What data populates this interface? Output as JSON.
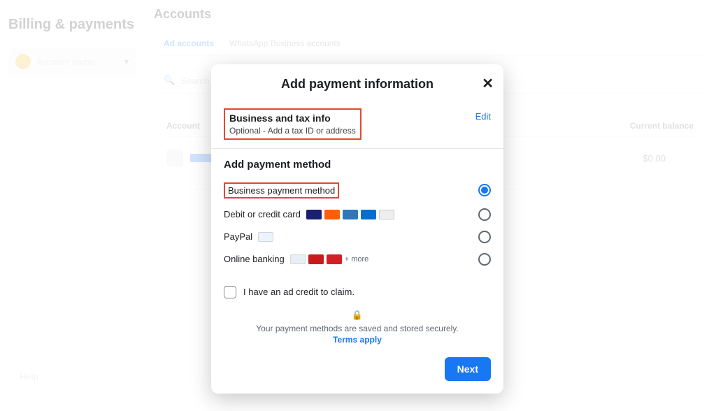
{
  "sidebar": {
    "title": "Billing & payments",
    "account_placeholder": "Account name",
    "help": "Help"
  },
  "main": {
    "title": "Accounts",
    "tabs": [
      "Ad accounts",
      "WhatsApp Business accounts"
    ],
    "search_placeholder": "Search by name or ID",
    "col_account": "Account",
    "col_balance": "Current balance",
    "row_balance": "$0.00"
  },
  "modal": {
    "title": "Add payment information",
    "btax_title": "Business and tax info",
    "btax_sub": "Optional - Add a tax ID or address",
    "edit": "Edit",
    "section_title": "Add payment method",
    "options": {
      "biz": "Business payment method",
      "card": "Debit or credit card",
      "paypal": "PayPal",
      "bank": "Online banking",
      "more": "+ more"
    },
    "credit_label": "I have an ad credit to claim.",
    "secure_msg": "Your payment methods are saved and stored securely.",
    "terms": "Terms apply",
    "next": "Next"
  }
}
